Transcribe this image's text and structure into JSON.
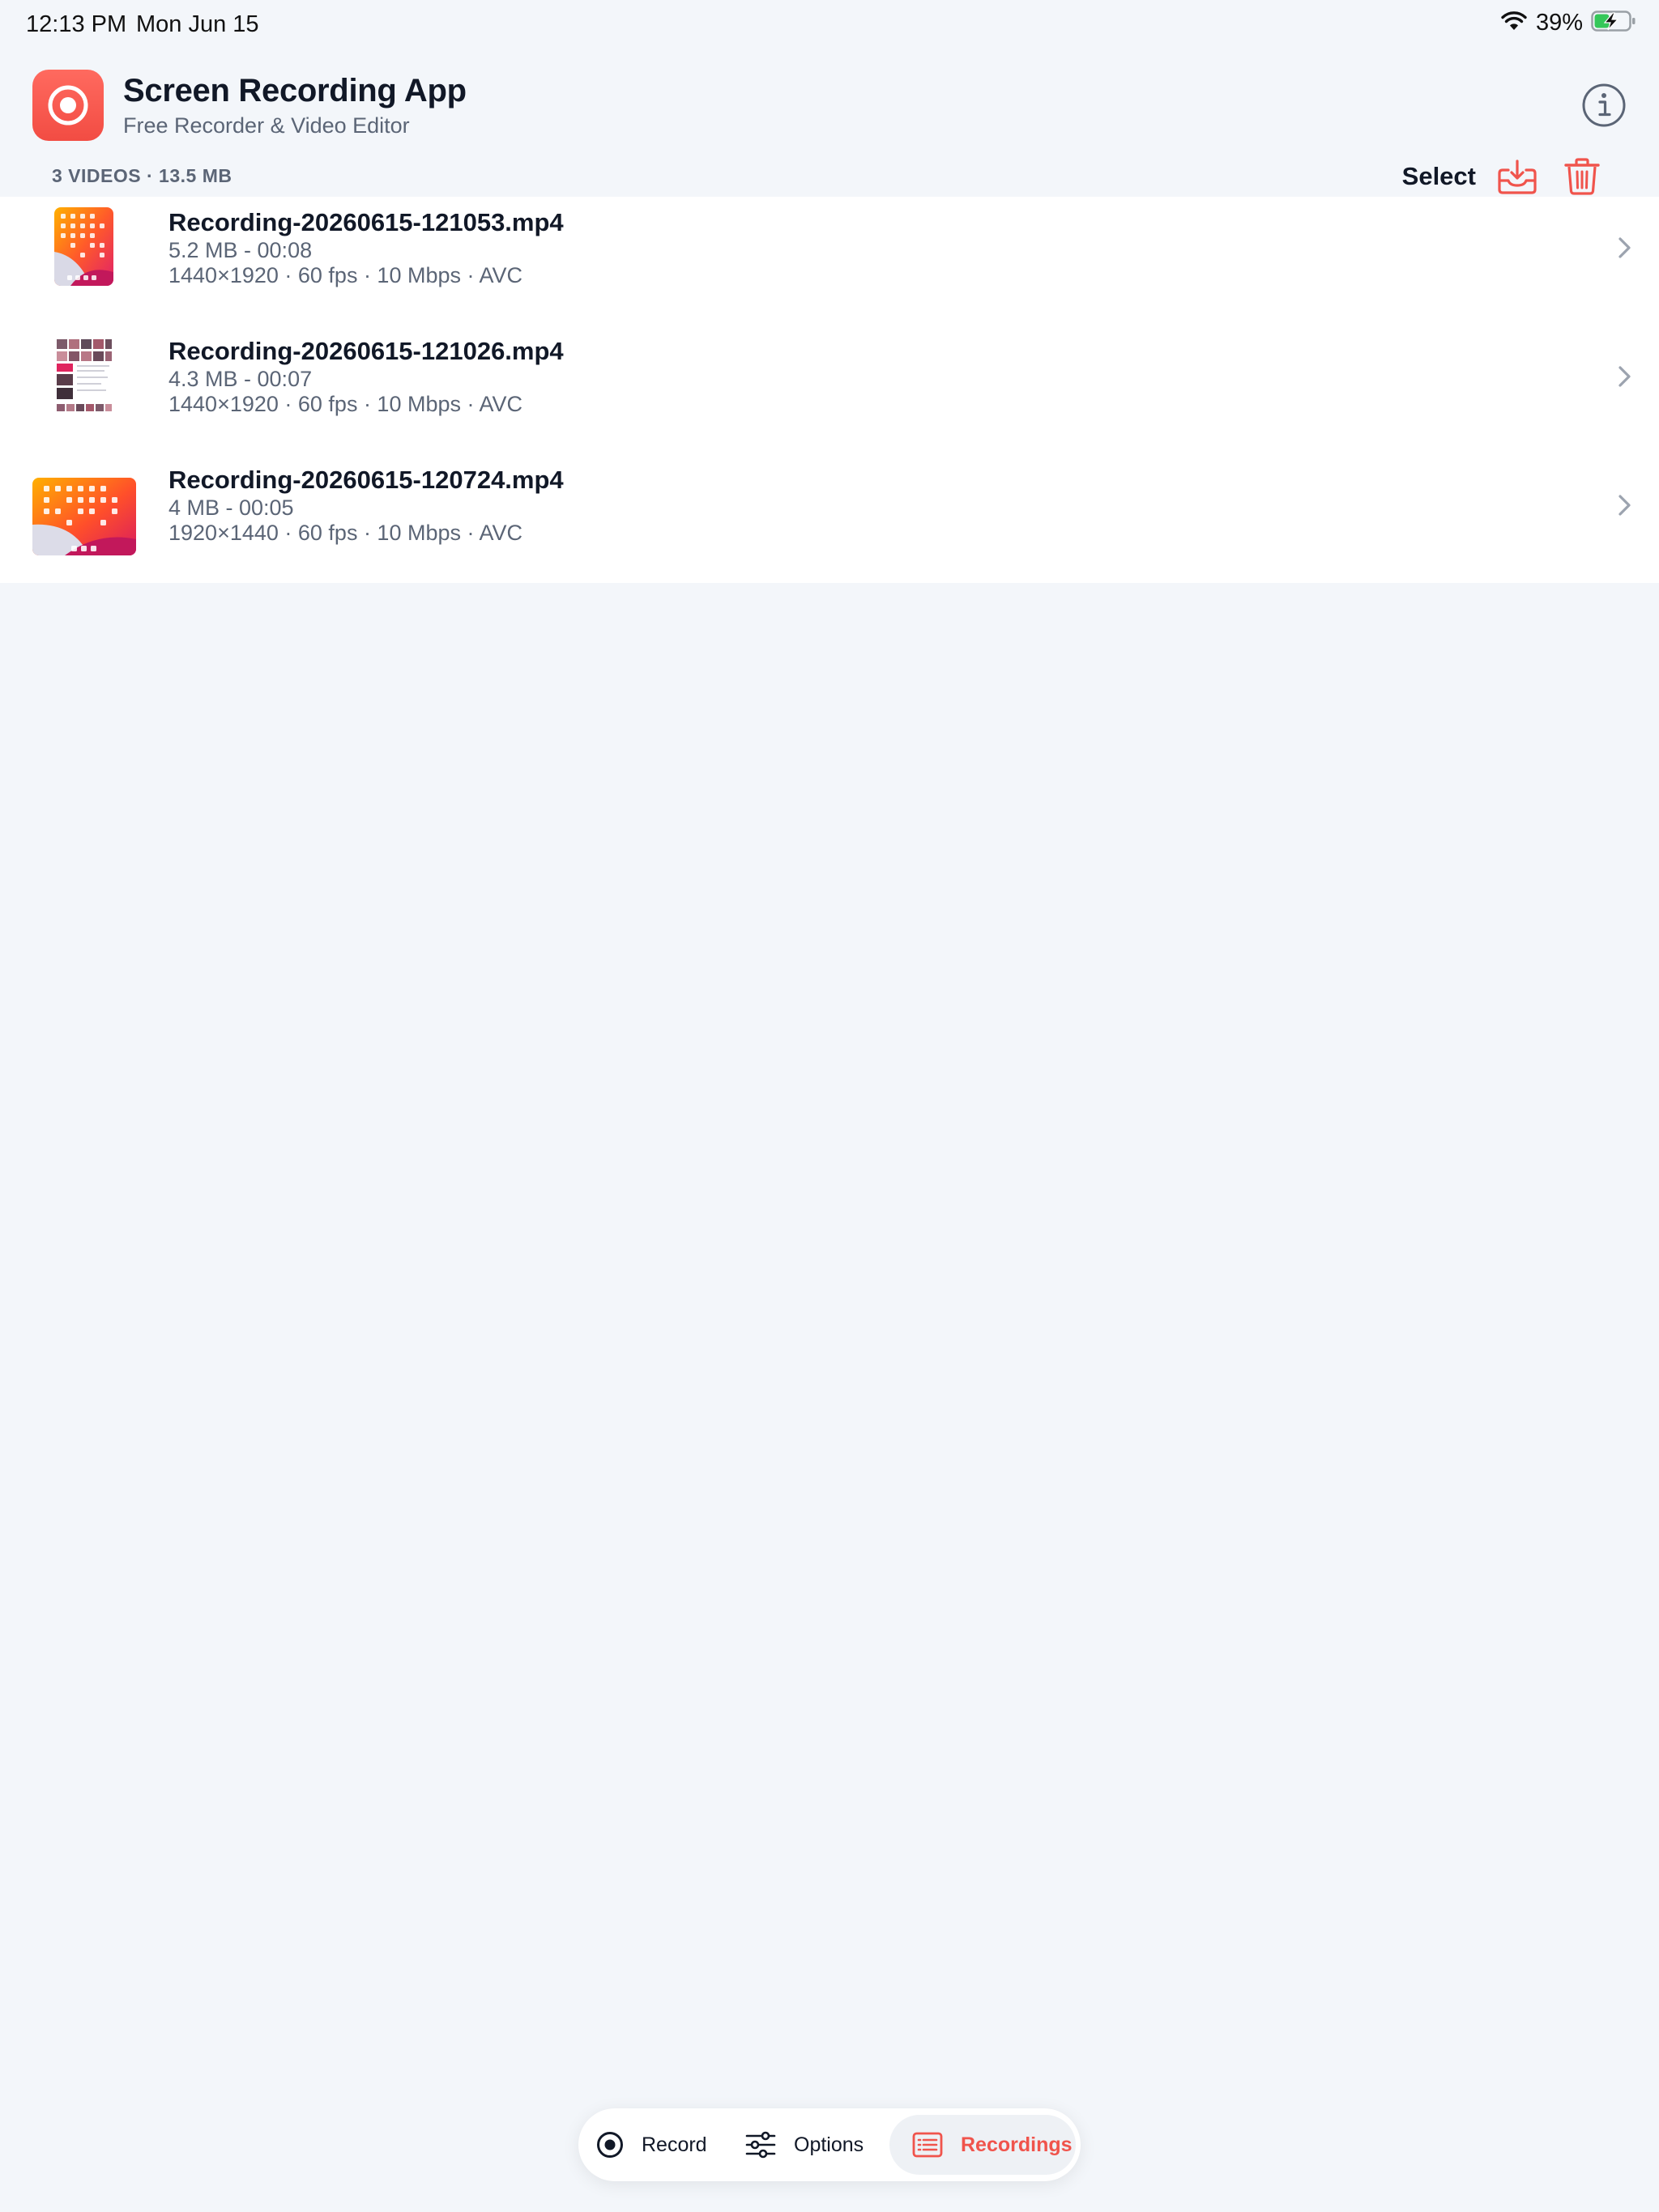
{
  "status_bar": {
    "time": "12:13 PM",
    "date": "Mon Jun 15",
    "battery_percent": "39%",
    "battery_level": 0.39,
    "charging": true,
    "icons": [
      "wifi-icon",
      "battery-charging-icon"
    ]
  },
  "header": {
    "app_icon": "record-icon",
    "title": "Screen Recording App",
    "subtitle": "Free Recorder & Video Editor",
    "info_icon": "info-icon"
  },
  "list_header": {
    "count_label": "3 VIDEOS · 13.5 MB",
    "select_label": "Select",
    "download_icon": "download-icon",
    "trash_icon": "trash-icon"
  },
  "recordings": [
    {
      "title": "Recording-20260615-121053.mp4",
      "size_duration": "5.2 MB - 00:08",
      "specs": "1440×1920 · 60 fps · 10 Mbps · AVC",
      "orientation": "portrait"
    },
    {
      "title": "Recording-20260615-121026.mp4",
      "size_duration": "4.3 MB - 00:07",
      "specs": "1440×1920 · 60 fps · 10 Mbps · AVC",
      "orientation": "portrait"
    },
    {
      "title": "Recording-20260615-120724.mp4",
      "size_duration": "4 MB - 00:05",
      "specs": "1920×1440 · 60 fps · 10 Mbps · AVC",
      "orientation": "landscape"
    }
  ],
  "tabbar": {
    "record_label": "Record",
    "options_label": "Options",
    "recordings_label": "Recordings",
    "active": "Recordings"
  },
  "colors": {
    "accent": "#f0544c",
    "background": "#f3f6fa",
    "text_primary": "#111827",
    "text_secondary": "#5b6576"
  }
}
